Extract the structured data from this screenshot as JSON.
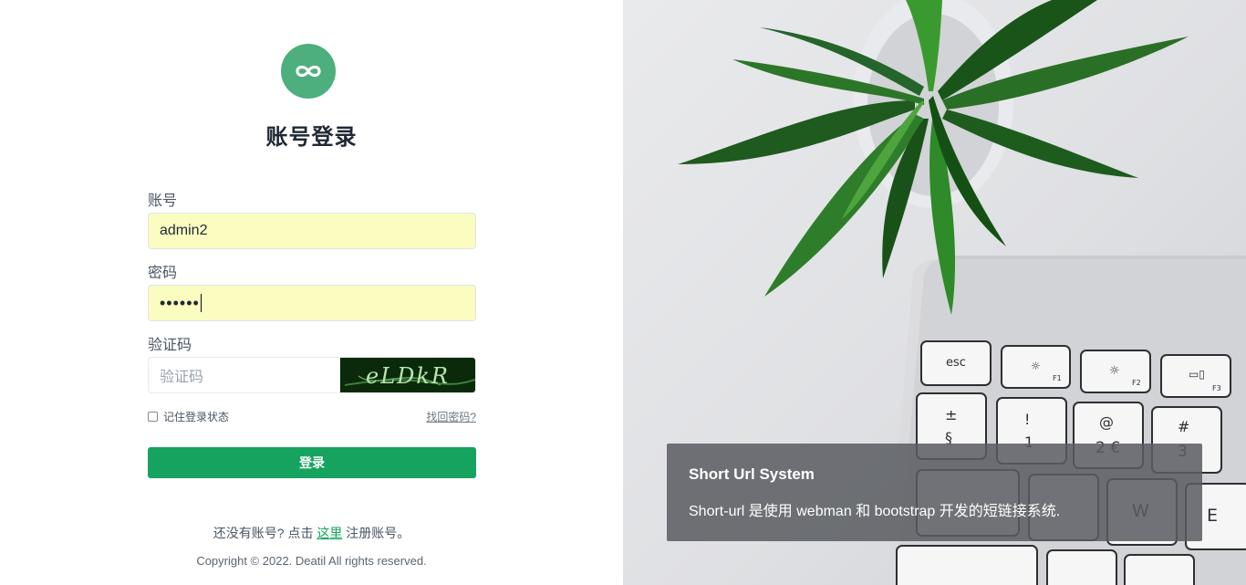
{
  "login": {
    "title": "账号登录",
    "fields": {
      "account": {
        "label": "账号",
        "value": "admin2"
      },
      "password": {
        "label": "密码",
        "value": "••••••"
      },
      "captcha": {
        "label": "验证码",
        "placeholder": "验证码",
        "image_text": "eLDkR"
      }
    },
    "remember_label": "记住登录状态",
    "forgot_label": "找回密码?",
    "submit_label": "登录",
    "register": {
      "prefix": "还没有账号? 点击 ",
      "link": "这里",
      "suffix": " 注册账号。"
    },
    "copyright": "Copyright © 2022. Deatil All rights reserved."
  },
  "hero": {
    "title": "Short Url System",
    "description": "Short-url 是使用 webman 和 bootstrap 开发的短链接系统.",
    "keyboard_keys": [
      "esc",
      "F1",
      "F2",
      "F3",
      "±",
      "§",
      "!",
      "1",
      "@",
      "2 €",
      "#",
      "3",
      "W",
      "E"
    ]
  },
  "colors": {
    "brand_green": "#16a35f",
    "logo_green": "#4caf7d",
    "autofill_yellow": "#fafcc0"
  },
  "icons": [
    "infinity-logo-icon",
    "checkbox-icon"
  ]
}
